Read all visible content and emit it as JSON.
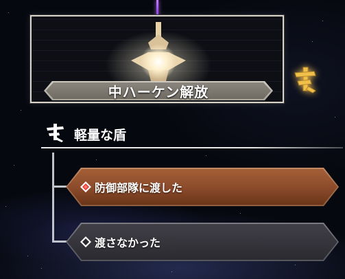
{
  "unlock_card": {
    "label": "中ハーケン解放",
    "image_icon": "glowing-spiked-emblem-icon"
  },
  "side_icon": "gold-route-glyph-icon",
  "choice_section": {
    "icon": "route-glyph-icon",
    "title": "軽量な盾",
    "options": [
      {
        "label": "防御部隊に渡した",
        "icon": "red-diamond-icon",
        "state": "selected"
      },
      {
        "label": "渡さなかった",
        "icon": "hollow-diamond-icon",
        "state": "unselected"
      }
    ]
  },
  "colors": {
    "selected_option": "#9a552f",
    "unselected_option": "#37363d",
    "gold_glyph": "#f0c14a",
    "beam": "#b36bff"
  }
}
